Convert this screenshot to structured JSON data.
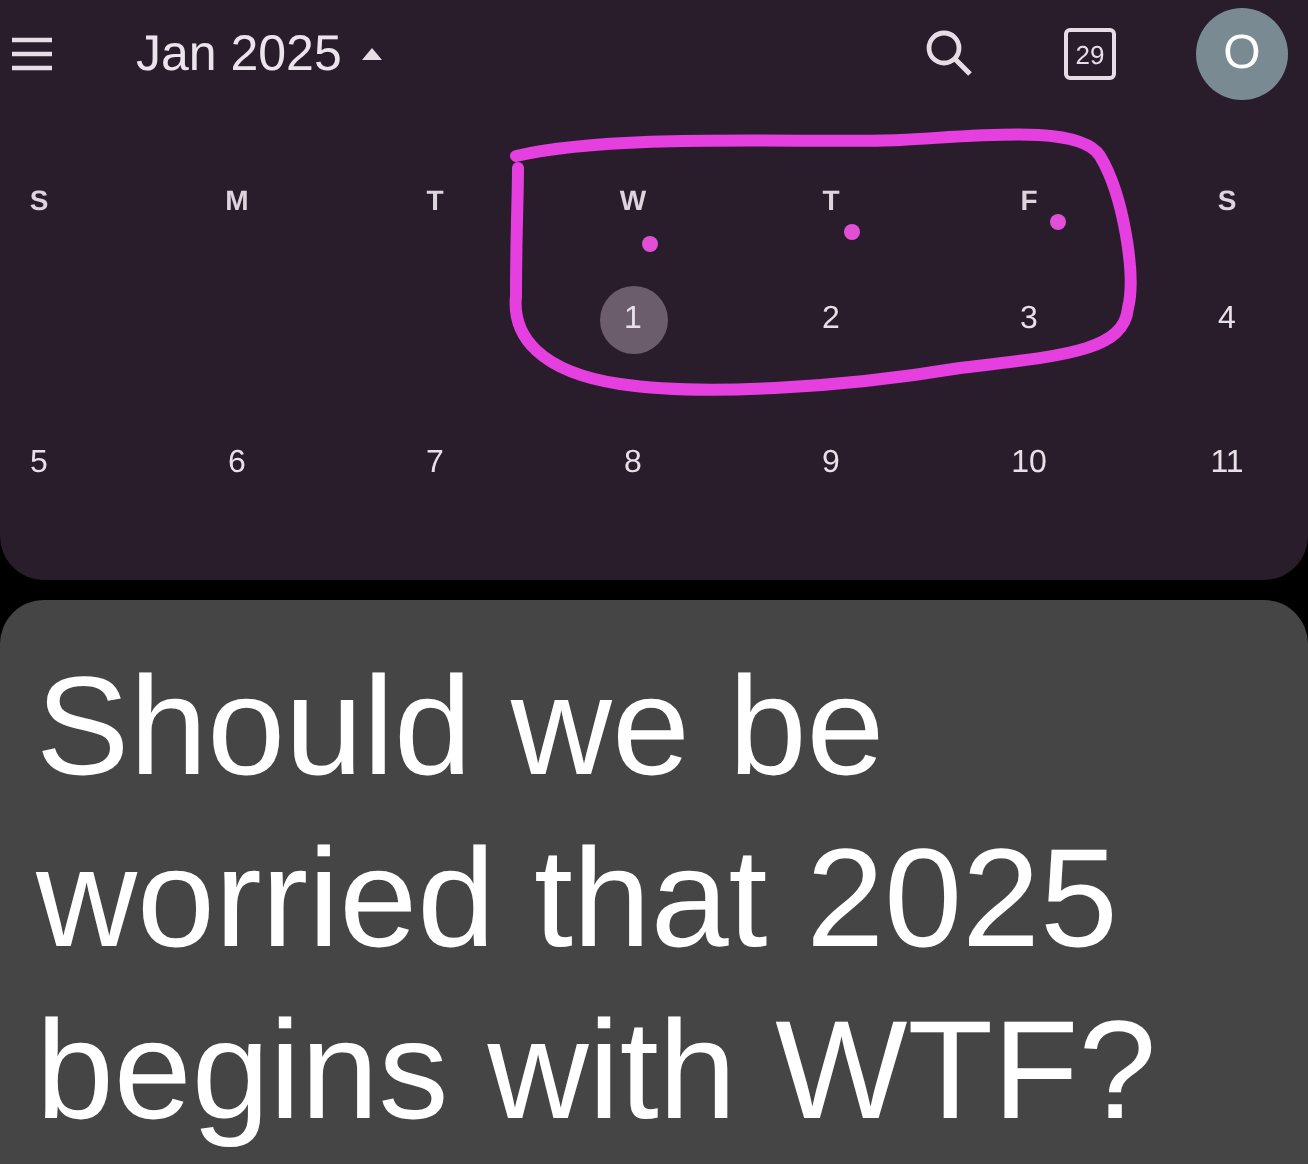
{
  "header": {
    "title": "Jan 2025",
    "calendar_day": "29",
    "avatar": "O"
  },
  "weekdays": [
    "S",
    "M",
    "T",
    "W",
    "T",
    "F",
    "S"
  ],
  "weeks": [
    [
      {
        "kind": "blank"
      },
      {
        "kind": "blank"
      },
      {
        "kind": "blank"
      },
      {
        "kind": "day",
        "day": "1",
        "selected": true,
        "has_event": true
      },
      {
        "kind": "day",
        "day": "2",
        "selected": false,
        "has_event": true
      },
      {
        "kind": "day",
        "day": "3",
        "selected": false,
        "has_event": true
      },
      {
        "kind": "day",
        "day": "4",
        "selected": false,
        "has_event": false
      }
    ],
    [
      {
        "kind": "day",
        "day": "5",
        "selected": false,
        "has_event": false
      },
      {
        "kind": "day",
        "day": "6",
        "selected": false,
        "has_event": false
      },
      {
        "kind": "day",
        "day": "7",
        "selected": false,
        "has_event": false
      },
      {
        "kind": "day",
        "day": "8",
        "selected": false,
        "has_event": false
      },
      {
        "kind": "day",
        "day": "9",
        "selected": false,
        "has_event": false
      },
      {
        "kind": "day",
        "day": "10",
        "selected": false,
        "has_event": false
      },
      {
        "kind": "day",
        "day": "11",
        "selected": false,
        "has_event": false
      }
    ]
  ],
  "caption": "Should we be worried that 2025 begins with WTF?"
}
